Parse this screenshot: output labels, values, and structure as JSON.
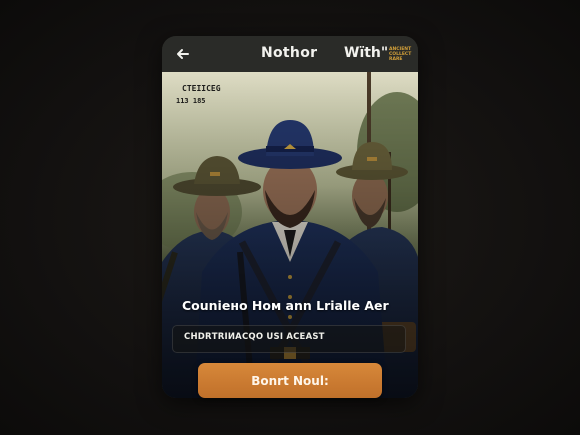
{
  "header": {
    "title_left": "Nothor",
    "title_right": "Wïth\"",
    "tiny_text": "ANCIENT\nCOLLECT\nRARE"
  },
  "photo": {
    "caption_line1": "CTEIICEG",
    "caption_line2": "113 185"
  },
  "overlay": {
    "headline": "Couniено Ном ann Lrialle Aer",
    "subtext": "CНDRТRIИACQO USI ACEAST"
  },
  "cta": {
    "label": "Bonrt Noul:"
  },
  "icons": {
    "back": "arrow-left-icon"
  },
  "colors": {
    "accent": "#c97a30",
    "header_bg": "#2a2b28",
    "page_bg": "#141210"
  }
}
